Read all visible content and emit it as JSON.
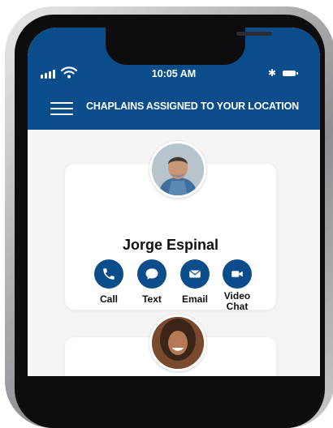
{
  "status_bar": {
    "time": "10:05 AM",
    "bluetooth_glyph": "✱"
  },
  "header": {
    "title": "CHAPLAINS ASSIGNED TO YOUR LOCATION"
  },
  "colors": {
    "brand_blue": "#0b4d8a",
    "background": "#f4f4f5"
  },
  "chaplains": [
    {
      "name": "Jorge Espinal",
      "actions": [
        {
          "label": "Call",
          "icon": "phone-icon"
        },
        {
          "label": "Text",
          "icon": "chat-bubble-icon"
        },
        {
          "label": "Email",
          "icon": "envelope-icon"
        },
        {
          "label": "Video Chat",
          "icon": "video-camera-icon"
        }
      ]
    },
    {
      "name": ""
    }
  ]
}
